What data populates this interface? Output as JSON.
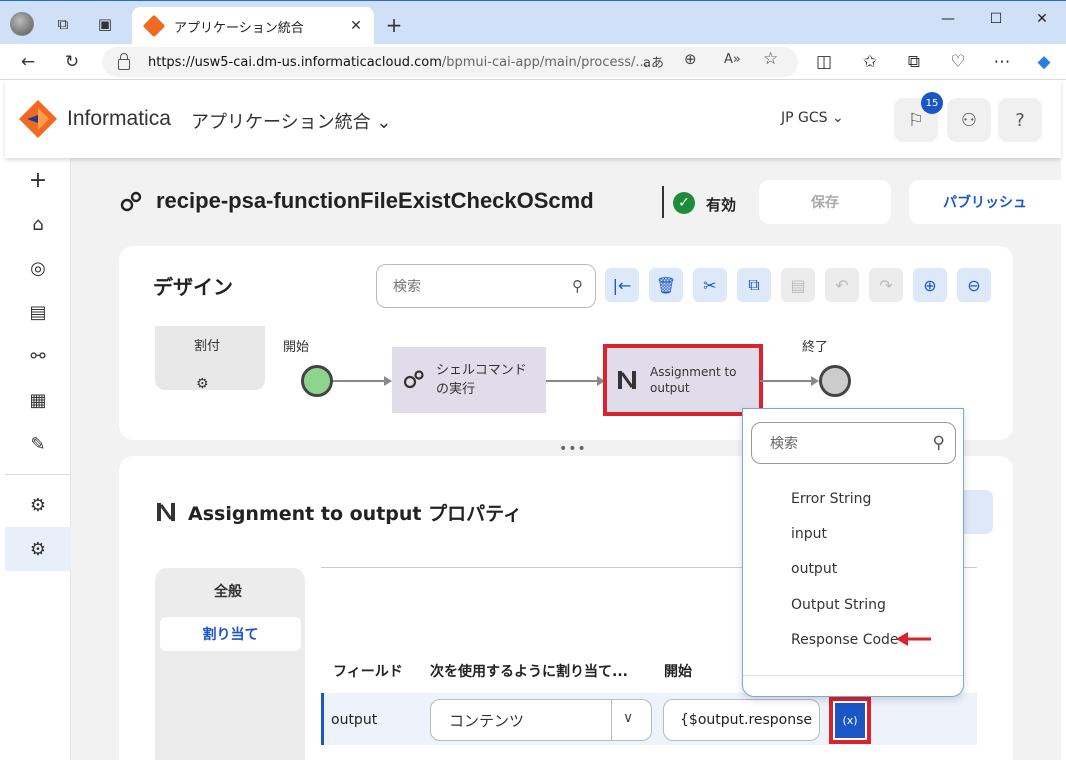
{
  "browser": {
    "tab_title": "アプリケーション統合",
    "url_host": "https://usw5-cai.dm-us.informaticacloud.com",
    "url_path": "/bpmui-cai-app/main/process/..."
  },
  "header": {
    "brand": "Informatica",
    "app_name": "アプリケーション統合",
    "org_name": "JP GCS",
    "notification_count": "15"
  },
  "process": {
    "title": "recipe-psa-functionFileExistCheckOScmd",
    "status": "有効",
    "save_label": "保存",
    "publish_label": "パブリッシュ"
  },
  "design": {
    "title": "デザイン",
    "search_placeholder": "検索",
    "assign_label": "割付",
    "start_label": "開始",
    "end_label": "終了",
    "step1": "シェルコマンドの実行",
    "step2": "Assignment to output"
  },
  "properties": {
    "title": "Assignment to output プロパティ",
    "tab_general": "全般",
    "tab_assign": "割り当て",
    "col_field": "フィールド",
    "col_assign_using": "次を使用するように割り当て...",
    "col_start": "開始",
    "row": {
      "field": "output",
      "assign_type": "コンテンツ",
      "expression": "{$output.response"
    },
    "fx_label": "(x)"
  },
  "dropdown": {
    "search_placeholder": "検索",
    "items": [
      "Error String",
      "input",
      "output",
      "Output String",
      "Response Code"
    ]
  },
  "colors": {
    "accent": "#1a56c6",
    "highlight": "#d9232f",
    "start_node": "#8ed48e",
    "step_bg": "#e1dcea"
  }
}
